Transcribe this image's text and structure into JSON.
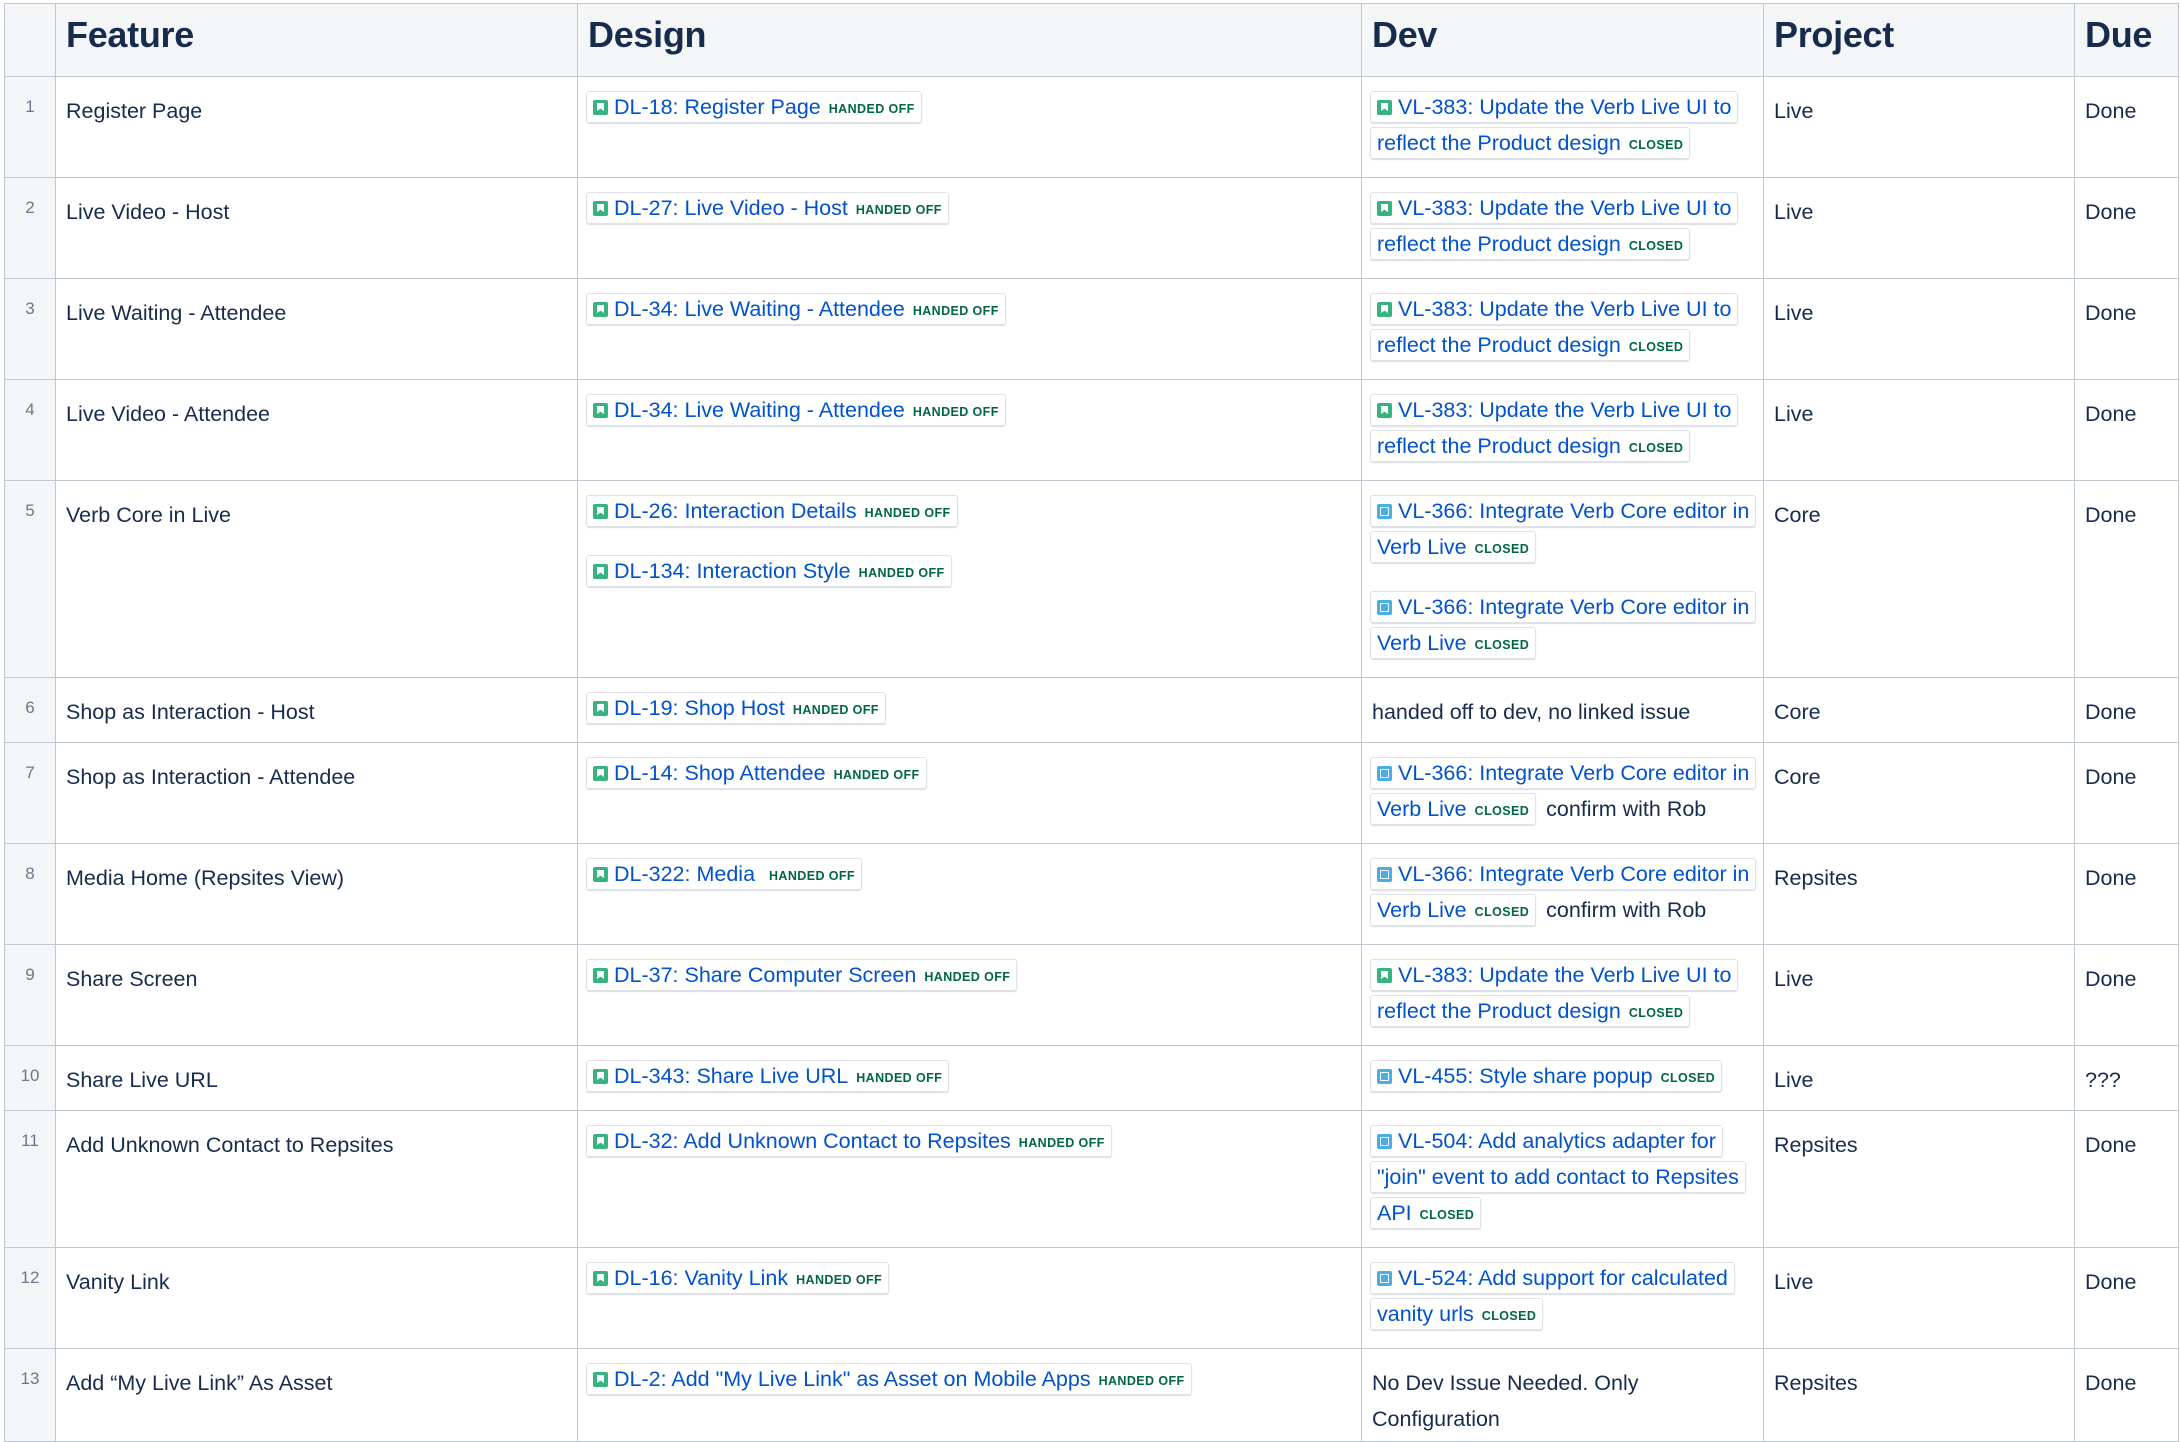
{
  "headers": {
    "feature": "Feature",
    "design": "Design",
    "dev": "Dev",
    "project": "Project",
    "due": "Due"
  },
  "status_colors": {
    "handed_off": "#006644",
    "closed": "#006644",
    "link": "#0052cc"
  },
  "rows": [
    {
      "num": "1",
      "feature": "Register Page",
      "design": [
        {
          "icon": "story-icon",
          "text": "DL-18: Register Page",
          "status": "HANDED OFF"
        }
      ],
      "dev": [
        {
          "icon": "story-icon",
          "text": "VL-383: Update the Verb Live UI to reflect the Product design",
          "status": "CLOSED"
        }
      ],
      "dev_text": "",
      "dev_note": "",
      "project": "Live",
      "due": "Done",
      "height": 67
    },
    {
      "num": "2",
      "feature": "Live Video  - Host",
      "design": [
        {
          "icon": "story-icon",
          "text": "DL-27: Live Video - Host",
          "status": "HANDED OFF"
        }
      ],
      "dev": [
        {
          "icon": "story-icon",
          "text": "VL-383: Update the Verb Live UI to reflect the Product design",
          "status": "CLOSED"
        }
      ],
      "dev_text": "",
      "dev_note": "",
      "project": "Live",
      "due": "Done",
      "height": 67
    },
    {
      "num": "3",
      "feature": "Live Waiting - Attendee",
      "design": [
        {
          "icon": "story-icon",
          "text": "DL-34: Live Waiting - Attendee",
          "status": "HANDED OFF"
        }
      ],
      "dev": [
        {
          "icon": "story-icon",
          "text": "VL-383: Update the Verb Live UI to reflect the Product design",
          "status": "CLOSED"
        }
      ],
      "dev_text": "",
      "dev_note": "",
      "project": "Live",
      "due": "Done",
      "height": 67
    },
    {
      "num": "4",
      "feature": "Live Video - Attendee",
      "design": [
        {
          "icon": "story-icon",
          "text": "DL-34: Live Waiting - Attendee",
          "status": "HANDED OFF"
        }
      ],
      "dev": [
        {
          "icon": "story-icon",
          "text": "VL-383: Update the Verb Live UI to reflect the Product design",
          "status": "CLOSED"
        }
      ],
      "dev_text": "",
      "dev_note": "",
      "project": "Live",
      "due": "Done",
      "height": 67
    },
    {
      "num": "5",
      "feature": "Verb Core in Live",
      "design": [
        {
          "icon": "story-icon",
          "text": "DL-26: Interaction Details",
          "status": "HANDED OFF"
        },
        {
          "icon": "story-icon",
          "text": "DL-134: Interaction Style",
          "status": "HANDED OFF"
        }
      ],
      "dev": [
        {
          "icon": "task-icon",
          "text": "VL-366: Integrate Verb Core editor in Verb Live",
          "status": "CLOSED"
        },
        {
          "icon": "task-icon",
          "text": "VL-366: Integrate Verb Core editor in Verb Live",
          "status": "CLOSED"
        }
      ],
      "dev_text": "",
      "dev_note": "",
      "project": "Core",
      "due": "Done",
      "height": 134
    },
    {
      "num": "6",
      "feature": "Shop as Interaction - Host",
      "design": [
        {
          "icon": "story-icon",
          "text": "DL-19: Shop Host",
          "status": "HANDED OFF"
        }
      ],
      "dev": [],
      "dev_text": "handed off to dev, no linked issue",
      "dev_note": "",
      "project": "Core",
      "due": "Done",
      "height": 41
    },
    {
      "num": "7",
      "feature": "Shop as Interaction - Attendee",
      "design": [
        {
          "icon": "story-icon",
          "text": "DL-14: Shop Attendee",
          "status": "HANDED OFF"
        }
      ],
      "dev": [
        {
          "icon": "task-icon",
          "text": "VL-366: Integrate Verb Core editor in Verb Live",
          "status": "CLOSED"
        }
      ],
      "dev_text": "",
      "dev_note": "confirm with Rob",
      "project": "Core",
      "due": "Done",
      "height": 67
    },
    {
      "num": "8",
      "feature": "Media Home (Repsites View)",
      "design": [
        {
          "icon": "story-icon",
          "text": "DL-322: Media ",
          "status": "HANDED OFF"
        }
      ],
      "dev": [
        {
          "icon": "task-icon",
          "text": "VL-366: Integrate Verb Core editor in Verb Live",
          "status": "CLOSED"
        }
      ],
      "dev_text": "",
      "dev_note": "confirm with Rob",
      "project": "Repsites",
      "due": "Done",
      "height": 67
    },
    {
      "num": "9",
      "feature": "Share Screen",
      "design": [
        {
          "icon": "story-icon",
          "text": "DL-37: Share Computer Screen",
          "status": "HANDED OFF"
        }
      ],
      "dev": [
        {
          "icon": "story-icon",
          "text": "VL-383: Update the Verb Live UI to reflect the Product design",
          "status": "CLOSED"
        }
      ],
      "dev_text": "",
      "dev_note": "",
      "project": "Live",
      "due": "Done",
      "height": 67
    },
    {
      "num": "10",
      "feature": "Share Live URL",
      "design": [
        {
          "icon": "story-icon",
          "text": "DL-343: Share Live URL",
          "status": "HANDED OFF"
        }
      ],
      "dev": [
        {
          "icon": "task-icon",
          "text": "VL-455: Style share popup",
          "status": "CLOSED"
        }
      ],
      "dev_text": "",
      "dev_note": "",
      "project": "Live",
      "due": "???",
      "height": 41
    },
    {
      "num": "11",
      "feature": "Add Unknown Contact to Repsites",
      "design": [
        {
          "icon": "story-icon",
          "text": "DL-32: Add Unknown Contact to Repsites",
          "status": "HANDED OFF"
        }
      ],
      "dev": [
        {
          "icon": "task-icon",
          "text": "VL-504: Add analytics adapter for \"join\" event to add contact to Repsites API",
          "status": "CLOSED"
        }
      ],
      "dev_text": "",
      "dev_note": "",
      "project": "Repsites",
      "due": "Done",
      "height": 93
    },
    {
      "num": "12",
      "feature": "Vanity Link",
      "design": [
        {
          "icon": "story-icon",
          "text": "DL-16: Vanity Link",
          "status": "HANDED OFF"
        }
      ],
      "dev": [
        {
          "icon": "task-icon",
          "text": "VL-524: Add support for calculated vanity urls",
          "status": "CLOSED"
        }
      ],
      "dev_text": "",
      "dev_note": "",
      "project": "Live",
      "due": "Done",
      "height": 67
    },
    {
      "num": "13",
      "feature": "Add “My Live Link” As Asset",
      "design": [
        {
          "icon": "story-icon",
          "text": "DL-2: Add \"My Live Link\" as Asset on Mobile Apps",
          "status": "HANDED OFF"
        }
      ],
      "dev": [],
      "dev_text": "No Dev Issue Needed. Only Configuration",
      "dev_note": "",
      "project": "Repsites",
      "due": "Done",
      "height": 67
    }
  ]
}
